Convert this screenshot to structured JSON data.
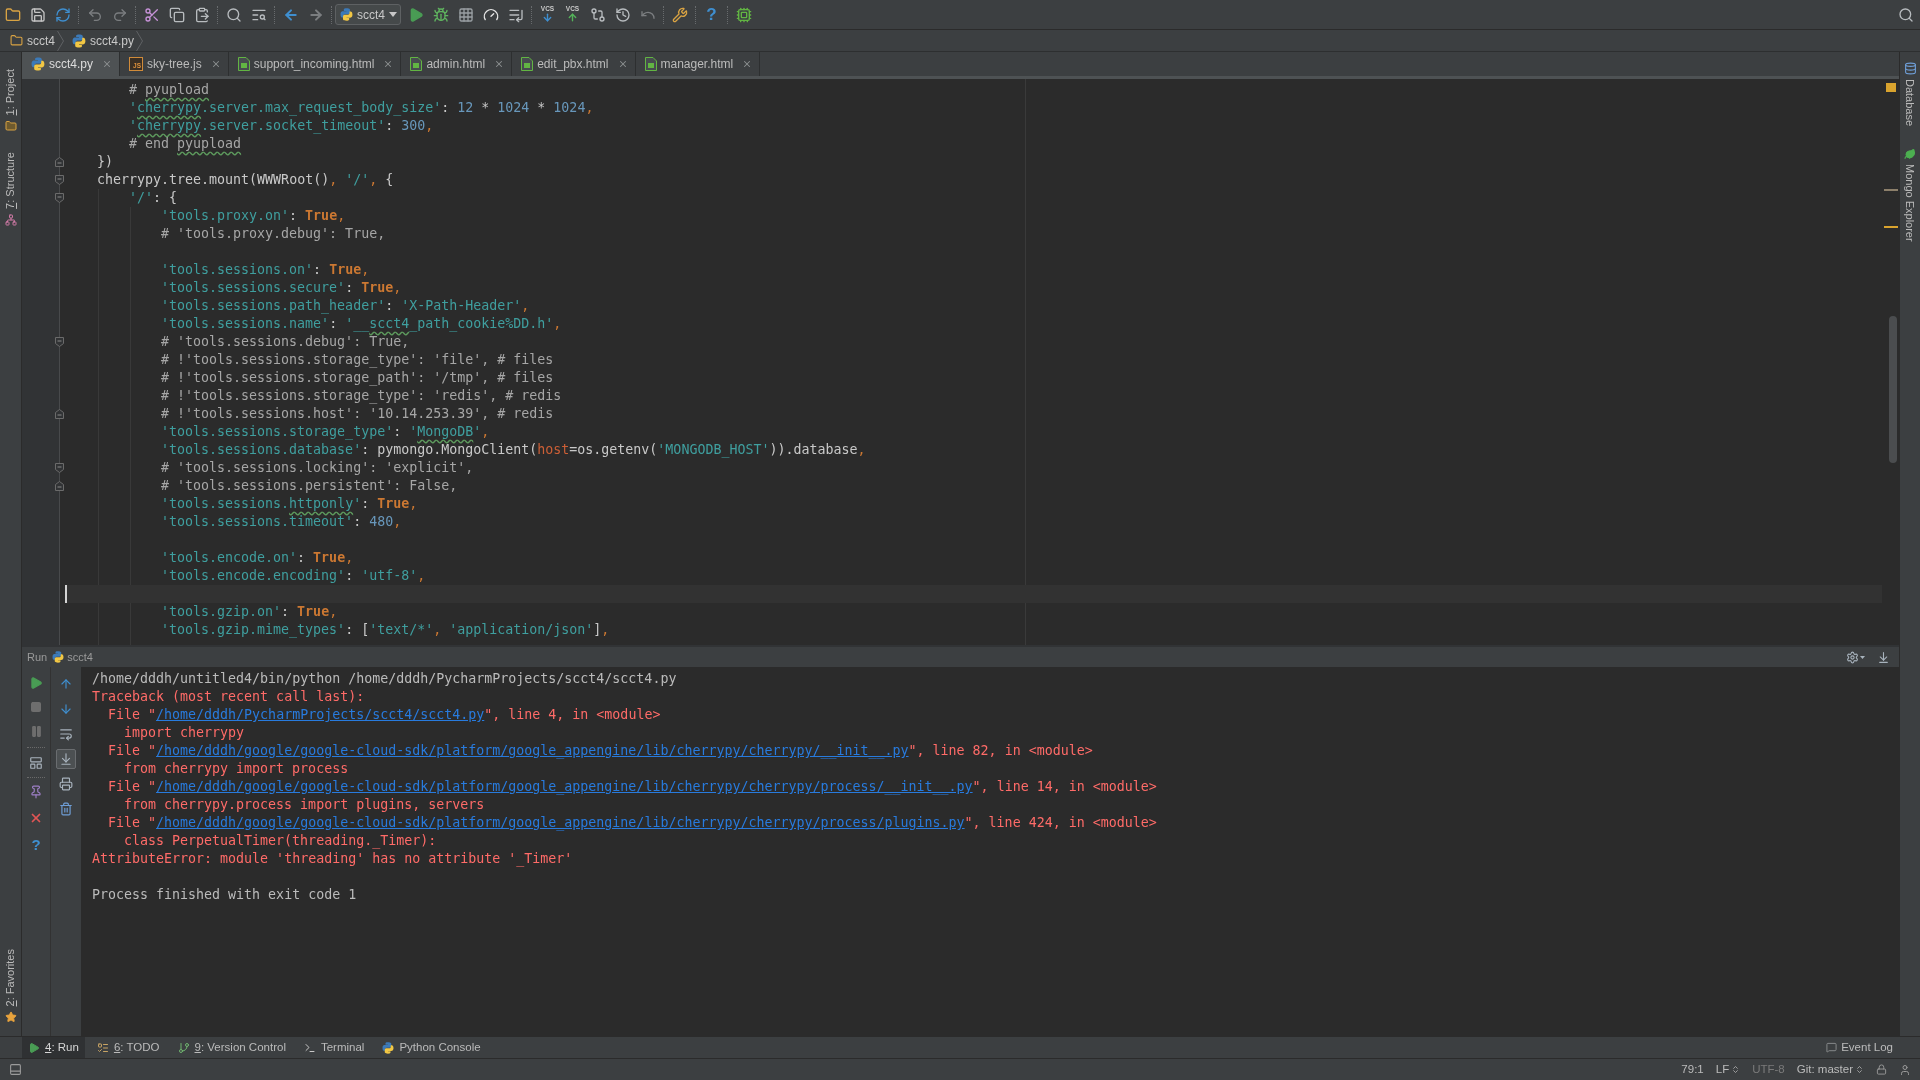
{
  "toolbar": {
    "run_config": "scct4",
    "vcs_labels": [
      "VCS",
      "VCS"
    ],
    "help_glyph": "?"
  },
  "breadcrumbs": [
    {
      "label": "scct4",
      "kind": "folder"
    },
    {
      "label": "scct4.py",
      "kind": "python"
    }
  ],
  "left_stripe": {
    "top": [
      {
        "label": "1: Project",
        "kind": "project",
        "mnemonic": true
      },
      {
        "label": "7: Structure",
        "kind": "structure",
        "mnemonic": true
      }
    ],
    "bottom": [
      {
        "label": "2: Favorites",
        "kind": "favorites",
        "mnemonic": true
      }
    ]
  },
  "right_stripe": [
    {
      "label": "Database",
      "kind": "database"
    },
    {
      "label": "Mongo Explorer",
      "kind": "mongo"
    }
  ],
  "tabs": [
    {
      "label": "scct4.py",
      "kind": "python",
      "selected": true
    },
    {
      "label": "sky-tree.js",
      "kind": "js",
      "icon_text": "JS",
      "selected": false
    },
    {
      "label": "support_incoming.html",
      "kind": "html",
      "selected": false
    },
    {
      "label": "admin.html",
      "kind": "html",
      "selected": false
    },
    {
      "label": "edit_pbx.html",
      "kind": "html",
      "selected": false
    },
    {
      "label": "manager.html",
      "kind": "html",
      "selected": false
    }
  ],
  "editor": {
    "lines": [
      {
        "kind": "group",
        "children": [
          {
            "fold_start": false,
            "fold_end": false,
            "caret": false,
            "tokens": [
              {
                "kind": "comment",
                "text": "# "
              },
              {
                "kind": "typocomment",
                "text": "pyupload"
              }
            ]
          },
          {
            "fold_start": false,
            "fold_end": false,
            "caret": false,
            "tokens": [
              {
                "kind": "string",
                "text": "'"
              },
              {
                "kind": "typostring",
                "text": "cherrypy"
              },
              {
                "kind": "string",
                "text": ".server.max_request_body_size'"
              },
              {
                "kind": "plain",
                "text": ": "
              },
              {
                "kind": "number",
                "text": "12"
              },
              {
                "kind": "plain",
                "text": " * "
              },
              {
                "kind": "number",
                "text": "1024"
              },
              {
                "kind": "plain",
                "text": " * "
              },
              {
                "kind": "number",
                "text": "1024"
              },
              {
                "kind": "punct",
                "text": ","
              }
            ]
          },
          {
            "fold_start": false,
            "fold_end": false,
            "caret": false,
            "tokens": [
              {
                "kind": "string",
                "text": "'"
              },
              {
                "kind": "typostring",
                "text": "cherrypy"
              },
              {
                "kind": "string",
                "text": ".server.socket_timeout'"
              },
              {
                "kind": "plain",
                "text": ": "
              },
              {
                "kind": "number",
                "text": "300"
              },
              {
                "kind": "punct",
                "text": ","
              }
            ]
          },
          {
            "fold_start": false,
            "fold_end": false,
            "caret": false,
            "tokens": [
              {
                "kind": "comment",
                "text": "# end "
              },
              {
                "kind": "typocomment",
                "text": "pyupload"
              }
            ]
          }
        ]
      },
      {
        "kind": "line",
        "fold_start": false,
        "fold_end": true,
        "caret": false,
        "tokens": [
          {
            "kind": "plain",
            "text": "})"
          }
        ]
      },
      {
        "kind": "line",
        "fold_start": true,
        "fold_end": false,
        "caret": false,
        "tokens": [
          {
            "kind": "plain",
            "text": "cherrypy.tree.mount(WWWRoot()"
          },
          {
            "kind": "punct",
            "text": ", "
          },
          {
            "kind": "string",
            "text": "'/'"
          },
          {
            "kind": "punct",
            "text": ", "
          },
          {
            "kind": "plain",
            "text": "{"
          }
        ],
        "children": [
          {
            "fold_start": true,
            "fold_end": false,
            "caret": false,
            "tokens": [
              {
                "kind": "string",
                "text": "'/'"
              },
              {
                "kind": "plain",
                "text": ": {"
              }
            ],
            "children": [
              {
                "fold_start": false,
                "fold_end": false,
                "caret": false,
                "tokens": [
                  {
                    "kind": "string",
                    "text": "'tools.proxy.on'"
                  },
                  {
                    "kind": "plain",
                    "text": ": "
                  },
                  {
                    "kind": "keyword",
                    "text": "True"
                  },
                  {
                    "kind": "punct",
                    "text": ","
                  }
                ]
              },
              {
                "fold_start": false,
                "fold_end": false,
                "caret": false,
                "tokens": [
                  {
                    "kind": "comment",
                    "text": "# 'tools.proxy.debug': True,"
                  }
                ]
              },
              {
                "fold_start": false,
                "fold_end": false,
                "caret": false
              },
              {
                "fold_start": false,
                "fold_end": false,
                "caret": false,
                "tokens": [
                  {
                    "kind": "string",
                    "text": "'tools.sessions.on'"
                  },
                  {
                    "kind": "plain",
                    "text": ": "
                  },
                  {
                    "kind": "keyword",
                    "text": "True"
                  },
                  {
                    "kind": "punct",
                    "text": ","
                  }
                ]
              },
              {
                "fold_start": false,
                "fold_end": false,
                "caret": false,
                "tokens": [
                  {
                    "kind": "string",
                    "text": "'tools.sessions.secure'"
                  },
                  {
                    "kind": "plain",
                    "text": ": "
                  },
                  {
                    "kind": "keyword",
                    "text": "True"
                  },
                  {
                    "kind": "punct",
                    "text": ","
                  }
                ]
              },
              {
                "fold_start": false,
                "fold_end": false,
                "caret": false,
                "tokens": [
                  {
                    "kind": "string",
                    "text": "'tools.sessions.path_header'"
                  },
                  {
                    "kind": "plain",
                    "text": ": "
                  },
                  {
                    "kind": "string",
                    "text": "'X-Path-Header'"
                  },
                  {
                    "kind": "punct",
                    "text": ","
                  }
                ]
              },
              {
                "fold_start": false,
                "fold_end": false,
                "caret": false,
                "tokens": [
                  {
                    "kind": "string",
                    "text": "'tools.sessions.name'"
                  },
                  {
                    "kind": "plain",
                    "text": ": "
                  },
                  {
                    "kind": "string",
                    "text": "'__"
                  },
                  {
                    "kind": "typostring",
                    "text": "scct4"
                  },
                  {
                    "kind": "string",
                    "text": "_path_cookie%DD.h'"
                  },
                  {
                    "kind": "punct",
                    "text": ","
                  }
                ]
              },
              {
                "fold_start": true,
                "fold_end": false,
                "caret": false,
                "tokens": [
                  {
                    "kind": "comment",
                    "text": "# 'tools.sessions.debug': True,"
                  }
                ]
              },
              {
                "fold_start": false,
                "fold_end": false,
                "caret": false,
                "tokens": [
                  {
                    "kind": "comment",
                    "text": "# !'tools.sessions.storage_type': 'file', # files"
                  }
                ]
              },
              {
                "fold_start": false,
                "fold_end": false,
                "caret": false,
                "tokens": [
                  {
                    "kind": "comment",
                    "text": "# !'tools.sessions.storage_path': '/tmp', # files"
                  }
                ]
              },
              {
                "fold_start": false,
                "fold_end": false,
                "caret": false,
                "tokens": [
                  {
                    "kind": "comment",
                    "text": "# !'tools.sessions.storage_type': 'redis', # redis"
                  }
                ]
              },
              {
                "fold_start": false,
                "fold_end": true,
                "caret": false,
                "tokens": [
                  {
                    "kind": "comment",
                    "text": "# !'tools.sessions.host': '10.14.253.39', # redis"
                  }
                ]
              },
              {
                "fold_start": false,
                "fold_end": false,
                "caret": false,
                "tokens": [
                  {
                    "kind": "string",
                    "text": "'tools.sessions.storage_type'"
                  },
                  {
                    "kind": "plain",
                    "text": ": "
                  },
                  {
                    "kind": "string",
                    "text": "'"
                  },
                  {
                    "kind": "typostring",
                    "text": "MongoDB"
                  },
                  {
                    "kind": "string",
                    "text": "'"
                  },
                  {
                    "kind": "punct",
                    "text": ","
                  }
                ]
              },
              {
                "fold_start": false,
                "fold_end": false,
                "caret": false,
                "tokens": [
                  {
                    "kind": "string",
                    "text": "'tools.sessions.database'"
                  },
                  {
                    "kind": "plain",
                    "text": ": pymongo.MongoClient("
                  },
                  {
                    "kind": "param",
                    "text": "host"
                  },
                  {
                    "kind": "plain",
                    "text": "=os.getenv("
                  },
                  {
                    "kind": "string",
                    "text": "'MONGODB_HOST'"
                  },
                  {
                    "kind": "plain",
                    "text": ")).database"
                  },
                  {
                    "kind": "punct",
                    "text": ","
                  }
                ]
              },
              {
                "fold_start": true,
                "fold_end": false,
                "caret": false,
                "tokens": [
                  {
                    "kind": "comment",
                    "text": "# 'tools.sessions.locking': 'explicit',"
                  }
                ]
              },
              {
                "fold_start": false,
                "fold_end": true,
                "caret": false,
                "tokens": [
                  {
                    "kind": "comment",
                    "text": "# 'tools.sessions.persistent': False,"
                  }
                ]
              },
              {
                "fold_start": false,
                "fold_end": false,
                "caret": false,
                "tokens": [
                  {
                    "kind": "string",
                    "text": "'tools.sessions."
                  },
                  {
                    "kind": "typostring",
                    "text": "httponly"
                  },
                  {
                    "kind": "string",
                    "text": "'"
                  },
                  {
                    "kind": "plain",
                    "text": ": "
                  },
                  {
                    "kind": "keyword",
                    "text": "True"
                  },
                  {
                    "kind": "punct",
                    "text": ","
                  }
                ]
              },
              {
                "fold_start": false,
                "fold_end": false,
                "caret": false,
                "tokens": [
                  {
                    "kind": "string",
                    "text": "'tools.sessions.timeout'"
                  },
                  {
                    "kind": "plain",
                    "text": ": "
                  },
                  {
                    "kind": "number",
                    "text": "480"
                  },
                  {
                    "kind": "punct",
                    "text": ","
                  }
                ]
              },
              {
                "fold_start": false,
                "fold_end": false,
                "caret": false
              },
              {
                "fold_start": false,
                "fold_end": false,
                "caret": false,
                "tokens": [
                  {
                    "kind": "string",
                    "text": "'tools.encode.on'"
                  },
                  {
                    "kind": "plain",
                    "text": ": "
                  },
                  {
                    "kind": "keyword",
                    "text": "True"
                  },
                  {
                    "kind": "punct",
                    "text": ","
                  }
                ]
              },
              {
                "fold_start": false,
                "fold_end": false,
                "caret": false,
                "tokens": [
                  {
                    "kind": "string",
                    "text": "'tools.encode.encoding'"
                  },
                  {
                    "kind": "plain",
                    "text": ": "
                  },
                  {
                    "kind": "string",
                    "text": "'utf-8'"
                  },
                  {
                    "kind": "punct",
                    "text": ","
                  }
                ]
              },
              {
                "fold_start": false,
                "fold_end": false,
                "caret": true
              },
              {
                "fold_start": false,
                "fold_end": false,
                "caret": false,
                "tokens": [
                  {
                    "kind": "string",
                    "text": "'tools.gzip.on'"
                  },
                  {
                    "kind": "plain",
                    "text": ": "
                  },
                  {
                    "kind": "keyword",
                    "text": "True"
                  },
                  {
                    "kind": "punct",
                    "text": ","
                  }
                ]
              },
              {
                "fold_start": false,
                "fold_end": false,
                "caret": false,
                "tokens": [
                  {
                    "kind": "string",
                    "text": "'tools.gzip.mime_types'"
                  },
                  {
                    "kind": "plain",
                    "text": ": ["
                  },
                  {
                    "kind": "string",
                    "text": "'text/*'"
                  },
                  {
                    "kind": "punct",
                    "text": ", "
                  },
                  {
                    "kind": "string",
                    "text": "'application/json'"
                  },
                  {
                    "kind": "plain",
                    "text": "]"
                  },
                  {
                    "kind": "punct",
                    "text": ","
                  }
                ]
              }
            ]
          }
        ]
      }
    ]
  },
  "run_panel": {
    "title": "Run",
    "config": "scct4",
    "help_glyph": "?",
    "side_tools": [
      {
        "pressed": false
      },
      {
        "pressed": false
      },
      {
        "pressed": false
      },
      {
        "pressed": true
      },
      {
        "pressed": false
      },
      {
        "pressed": false
      }
    ],
    "console_blocks": [
      {
        "lines": [
          {
            "tokens": [
              {
                "kind": "out",
                "text": "/home/dddh/untitled4/bin/python /home/dddh/PycharmProjects/scct4/scct4.py"
              }
            ]
          },
          {
            "tokens": [
              {
                "kind": "err",
                "text": "Traceback (most recent call last):"
              }
            ],
            "children": [
              {
                "tokens": [
                  {
                    "kind": "err",
                    "text": "File \""
                  },
                  {
                    "kind": "link",
                    "text": "/home/dddh/PycharmProjects/scct4/scct4.py"
                  },
                  {
                    "kind": "err",
                    "text": "\", line 4, in <module>"
                  }
                ],
                "children": [
                  {
                    "tokens": [
                      {
                        "kind": "err",
                        "text": "import cherrypy"
                      }
                    ]
                  }
                ]
              },
              {
                "tokens": [
                  {
                    "kind": "err",
                    "text": "File \""
                  },
                  {
                    "kind": "link",
                    "text": "/home/dddh/google/google-cloud-sdk/platform/google_appengine/lib/cherrypy/cherrypy/__init__.py"
                  },
                  {
                    "kind": "err",
                    "text": "\", line 82, in <module>"
                  }
                ],
                "children": [
                  {
                    "tokens": [
                      {
                        "kind": "err",
                        "text": "from cherrypy import process"
                      }
                    ]
                  }
                ]
              },
              {
                "tokens": [
                  {
                    "kind": "err",
                    "text": "File \""
                  },
                  {
                    "kind": "link",
                    "text": "/home/dddh/google/google-cloud-sdk/platform/google_appengine/lib/cherrypy/cherrypy/process/__init__.py"
                  },
                  {
                    "kind": "err",
                    "text": "\", line 14, in <module>"
                  }
                ],
                "children": [
                  {
                    "tokens": [
                      {
                        "kind": "err",
                        "text": "from cherrypy.process import plugins, servers"
                      }
                    ]
                  }
                ]
              },
              {
                "tokens": [
                  {
                    "kind": "err",
                    "text": "File \""
                  },
                  {
                    "kind": "link",
                    "text": "/home/dddh/google/google-cloud-sdk/platform/google_appengine/lib/cherrypy/cherrypy/process/plugins.py"
                  },
                  {
                    "kind": "err",
                    "text": "\", line 424, in <module>"
                  }
                ],
                "children": [
                  {
                    "tokens": [
                      {
                        "kind": "err",
                        "text": "class PerpetualTimer(threading._Timer):"
                      }
                    ]
                  }
                ]
              }
            ]
          },
          {
            "tokens": [
              {
                "kind": "err",
                "text": "AttributeError: module 'threading' has no attribute '_Timer'"
              }
            ]
          }
        ]
      },
      {
        "lines": [
          {
            "tokens": [
              {
                "kind": "out",
                "text": "Process finished with exit code 1"
              }
            ]
          }
        ]
      }
    ]
  },
  "tool_windows": [
    {
      "label": "4: Run",
      "kind": "run",
      "mnemonic": true,
      "selected": true
    },
    {
      "label": "6: TODO",
      "kind": "todo",
      "mnemonic": true,
      "selected": false
    },
    {
      "label": "9: Version Control",
      "kind": "vcs",
      "mnemonic": true,
      "selected": false
    },
    {
      "label": "Terminal",
      "kind": "terminal",
      "mnemonic": false,
      "selected": false
    },
    {
      "label": "Python Console",
      "kind": "console",
      "mnemonic": false,
      "selected": false
    }
  ],
  "event_log": {
    "label": "Event Log"
  },
  "status_bar": {
    "items": [
      {
        "text": "79:1",
        "kind": "plain",
        "disabled": false
      },
      {
        "text": "LF",
        "kind": "menu",
        "disabled": false
      },
      {
        "text": "UTF-8",
        "kind": "plain",
        "disabled": true
      },
      {
        "text": "Git: master",
        "kind": "menu",
        "disabled": false
      }
    ]
  }
}
